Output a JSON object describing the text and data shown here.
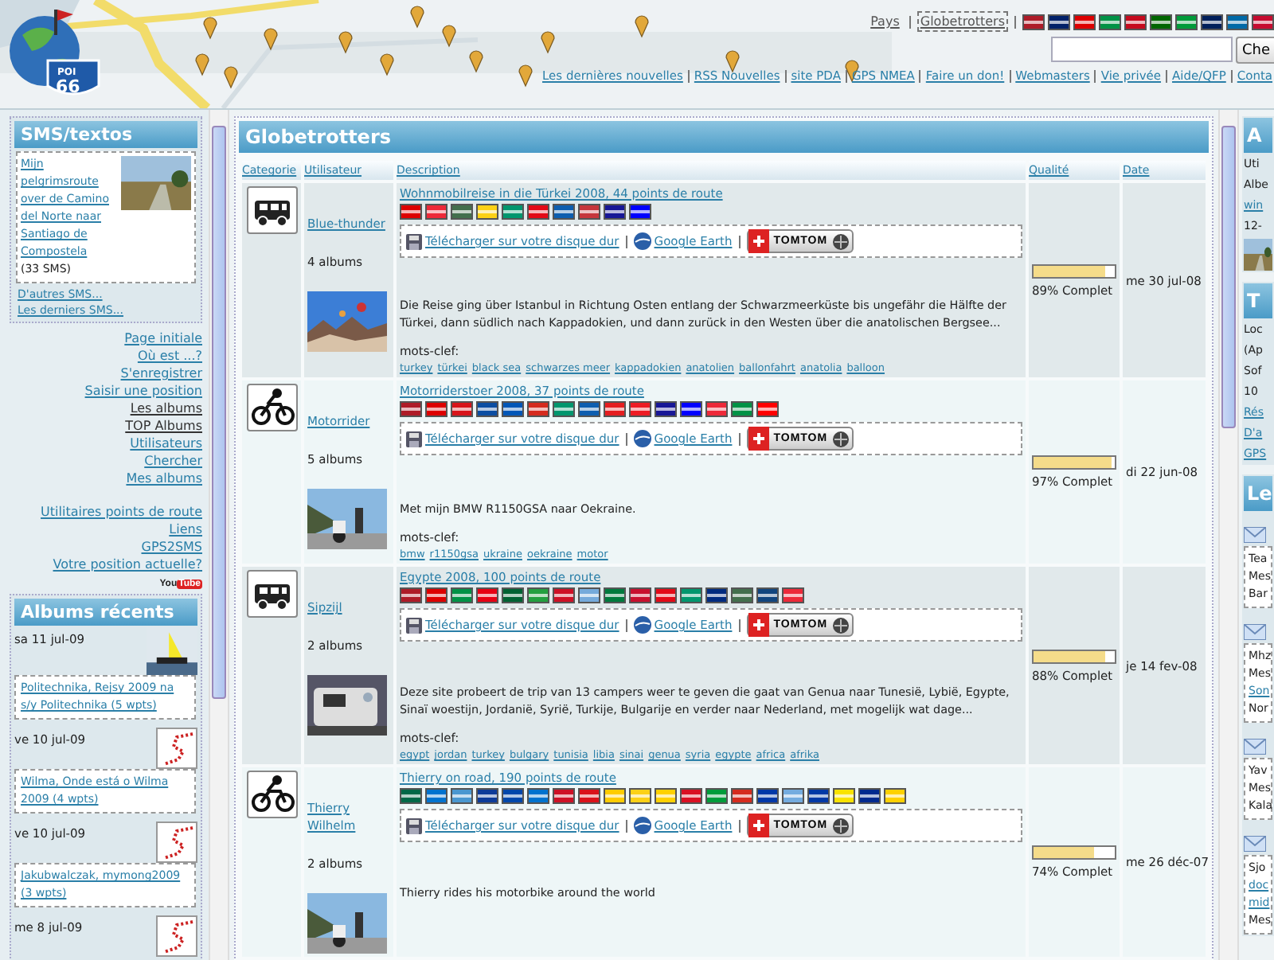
{
  "logo": {
    "top": "POI",
    "number": "66"
  },
  "header": {
    "tabs": [
      {
        "label": "Pays",
        "selected": false
      },
      {
        "label": "Globetrotters",
        "selected": true
      }
    ],
    "flags": [
      {
        "color": "#ae1c28"
      },
      {
        "color": "#012169"
      },
      {
        "color": "#dd0000"
      },
      {
        "color": "#009246"
      },
      {
        "color": "#c60b1e"
      },
      {
        "color": "#006600"
      },
      {
        "color": "#009b3a"
      },
      {
        "color": "#00205b"
      },
      {
        "color": "#006aa7"
      },
      {
        "color": "#c60c30"
      }
    ],
    "search": {
      "button": "Che"
    },
    "nav": [
      "Les dernières nouvelles",
      "RSS Nouvelles",
      "site PDA",
      "GPS NMEA",
      "Faire un don!",
      "Webmasters",
      "Vie privée",
      "Aide/QFP",
      "Conta"
    ]
  },
  "sms": {
    "title": "SMS/textos",
    "item": {
      "link": "Mijn pelgrimsroute over de Camino del Norte naar Santiago de Compostela",
      "count": "(33 SMS)"
    },
    "links": [
      "D'autres SMS...",
      "Les derniers SMS..."
    ]
  },
  "menu": [
    {
      "label": "Page initiale",
      "kind": "link"
    },
    {
      "label": "Où est ...?",
      "kind": "link"
    },
    {
      "label": "S'enregistrer",
      "kind": "link"
    },
    {
      "label": "Saisir une position",
      "kind": "link"
    },
    {
      "label": "Les albums",
      "kind": "plain"
    },
    {
      "label": "TOP Albums",
      "kind": "plain"
    },
    {
      "label": "Utilisateurs",
      "kind": "link"
    },
    {
      "label": "Chercher",
      "kind": "link"
    },
    {
      "label": "Mes albums",
      "kind": "link"
    },
    {
      "label": "Utilitaires points de route",
      "kind": "link"
    },
    {
      "label": "Liens",
      "kind": "link"
    },
    {
      "label": "GPS2SMS",
      "kind": "link"
    },
    {
      "label": "Votre position actuelle?",
      "kind": "link"
    }
  ],
  "youtube": {
    "you": "You",
    "tube": "Tube"
  },
  "recent": {
    "title": "Albums récents",
    "items": [
      {
        "date": "sa 11 jul-09",
        "link": "Politechnika, Rejsy 2009 na s/y Politechnika (5 wpts)",
        "kind": "picture"
      },
      {
        "date": "ve 10 jul-09",
        "link": "Wilma, Onde está o Wilma 2009 (4 wpts)",
        "kind": "route"
      },
      {
        "date": "ve 10 jul-09",
        "link": "Jakubwalczak, mymong2009 (3 wpts)",
        "kind": "route"
      },
      {
        "date": "me 8 jul-09",
        "kind": "route"
      }
    ]
  },
  "main": {
    "title": "Globetrotters",
    "columns": [
      "Categorie",
      "Utilisateur",
      "Description",
      "Qualité",
      "Date"
    ],
    "rows": [
      {
        "kind": "camper",
        "user": "Blue-thunder",
        "albums": "4 albums",
        "title": "Wohnmobilreise in die Türkei 2008, 44 points de route",
        "flags": [
          {
            "color": "#dd0000"
          },
          {
            "color": "#ed2939"
          },
          {
            "color": "#436f4d"
          },
          {
            "color": "#fcd116"
          },
          {
            "color": "#00966e"
          },
          {
            "color": "#e30a17"
          },
          {
            "color": "#0d5eaf"
          },
          {
            "color": "#c6363c"
          },
          {
            "color": "#171796"
          },
          {
            "color": "#0000ff"
          }
        ],
        "download": "Télécharger sur votre disque dur",
        "earth": "Google Earth",
        "tomtom": "TOMTOM",
        "description": "Die Reise ging über Istanbul in Richtung Osten entlang der Schwarzmeerküste bis ungefähr die Hälfte der Türkei, dann südlich nach Kappadokien, und dann zurück in den Westen über die anatolischen Bergsee...",
        "keywords_label": "mots-clef:",
        "keywords": [
          "turkey",
          "türkei",
          "black sea",
          "schwarzes meer",
          "kappadokien",
          "anatolien",
          "ballonfahrt",
          "anatolia",
          "balloon"
        ],
        "level": 0.89,
        "quality": "89% Complet",
        "date": "me 30 jul-08"
      },
      {
        "kind": "motorbike",
        "user": "Motorrider",
        "albums": "5 albums",
        "title": "Motorriderstoer 2008, 37 points de route",
        "flags": [
          {
            "color": "#ae1c28"
          },
          {
            "color": "#dd0000"
          },
          {
            "color": "#d7141a"
          },
          {
            "color": "#0b4ea2"
          },
          {
            "color": "#0057b7"
          },
          {
            "color": "#d52b1e"
          },
          {
            "color": "#00966e"
          },
          {
            "color": "#0d5eaf"
          },
          {
            "color": "#e41e20"
          },
          {
            "color": "#ed1c24"
          },
          {
            "color": "#171796"
          },
          {
            "color": "#0000ff"
          },
          {
            "color": "#ed2939"
          },
          {
            "color": "#009246"
          },
          {
            "color": "#ff0000"
          }
        ],
        "download": "Télécharger sur votre disque dur",
        "earth": "Google Earth",
        "tomtom": "TOMTOM",
        "description": "Met mijn BMW R1150GSA naar Oekraine.",
        "keywords_label": "mots-clef:",
        "keywords": [
          "bmw",
          "r1150gsa",
          "ukraine",
          "oekraine",
          "motor"
        ],
        "level": 0.97,
        "quality": "97% Complet",
        "date": "di 22 jun-08"
      },
      {
        "kind": "camper",
        "user": "Sipzijl",
        "albums": "2 albums",
        "title": "Egypte 2008, 100 points de route",
        "flags": [
          {
            "color": "#ae1c28"
          },
          {
            "color": "#dd0000"
          },
          {
            "color": "#009246"
          },
          {
            "color": "#e70013"
          },
          {
            "color": "#006233"
          },
          {
            "color": "#239f40"
          },
          {
            "color": "#ce1126"
          },
          {
            "color": "#75aadb"
          },
          {
            "color": "#007a3d"
          },
          {
            "color": "#c8102e"
          },
          {
            "color": "#e30a17"
          },
          {
            "color": "#00966e"
          },
          {
            "color": "#002b7f"
          },
          {
            "color": "#436f4d"
          },
          {
            "color": "#11457e"
          },
          {
            "color": "#ed2939"
          }
        ],
        "download": "Télécharger sur votre disque dur",
        "earth": "Google Earth",
        "tomtom": "TOMTOM",
        "description": "Deze site probeert de trip van 13 campers weer te geven die gaat van Genua naar Tunesië, Lybië, Egypte, Sinaï woestijn, Jordanië, Syrië, Turkije, Bulgarije en verder naar Nederland, met mogelijk wat dage...",
        "keywords_label": "mots-clef:",
        "keywords": [
          "egypt",
          "jordan",
          "turkey",
          "bulgary",
          "tunisia",
          "libia",
          "sinai",
          "genua",
          "syria",
          "egypte",
          "africa",
          "afrika"
        ],
        "level": 0.88,
        "quality": "88% Complet",
        "date": "je 14 fev-08"
      },
      {
        "kind": "motorbike",
        "user": "Thierry Wilhelm",
        "albums": "2 albums",
        "title": "Thierry on road, 190 points de route",
        "flags": [
          {
            "color": "#006847"
          },
          {
            "color": "#0073cf"
          },
          {
            "color": "#4997d0"
          },
          {
            "color": "#0d3b99"
          },
          {
            "color": "#0047ab"
          },
          {
            "color": "#0072ce"
          },
          {
            "color": "#ce1126"
          },
          {
            "color": "#da121a"
          },
          {
            "color": "#ffcc00"
          },
          {
            "color": "#fcd116"
          },
          {
            "color": "#ffd100"
          },
          {
            "color": "#d91023"
          },
          {
            "color": "#009c3b"
          },
          {
            "color": "#d52b1e"
          },
          {
            "color": "#0038a8"
          },
          {
            "color": "#74acdf"
          },
          {
            "color": "#0039a6"
          },
          {
            "color": "#f9e300"
          },
          {
            "color": "#002a8f"
          },
          {
            "color": "#fed100"
          }
        ],
        "download": "Télécharger sur votre disque dur",
        "earth": "Google Earth",
        "tomtom": "TOMTOM",
        "description": "Thierry rides his motorbike around the world",
        "level": 0.74,
        "quality": "74% Complet",
        "date": "me 26 déc-07"
      }
    ]
  },
  "right": {
    "panels": [
      {
        "title": "A",
        "lines": [
          {
            "text": "Uti",
            "kind": "text"
          },
          {
            "text": "Albe",
            "kind": "text"
          },
          {
            "text": "win",
            "kind": "link"
          },
          {
            "text": "12-",
            "kind": "text"
          }
        ]
      },
      {
        "title": "T",
        "lines": [
          {
            "text": "Loc",
            "kind": "text"
          },
          {
            "text": "(Ap",
            "kind": "text"
          },
          {
            "text": "Sof",
            "kind": "text"
          },
          {
            "text": "10",
            "kind": "text"
          },
          {
            "text": "Rés",
            "kind": "link"
          },
          {
            "text": "D'a",
            "kind": "link"
          },
          {
            "text": "GPS",
            "kind": "link"
          }
        ]
      },
      {
        "title": "Le",
        "messages": [
          [
            {
              "text": "Tea",
              "kind": "text"
            },
            {
              "text": "Mes",
              "kind": "text"
            },
            {
              "text": "Bar",
              "kind": "text"
            }
          ],
          [
            {
              "text": "Mhz",
              "kind": "text"
            },
            {
              "text": "Mes",
              "kind": "text"
            },
            {
              "text": "Son",
              "kind": "link"
            },
            {
              "text": "Nor",
              "kind": "text"
            }
          ],
          [
            {
              "text": "Yav",
              "kind": "text"
            },
            {
              "text": "Mes",
              "kind": "text"
            },
            {
              "text": "Kala",
              "kind": "text"
            }
          ],
          [
            {
              "text": "Sjo",
              "kind": "text"
            },
            {
              "text": "doc",
              "kind": "link"
            },
            {
              "text": "mid",
              "kind": "link"
            },
            {
              "text": "Mes",
              "kind": "text"
            }
          ]
        ]
      }
    ]
  }
}
